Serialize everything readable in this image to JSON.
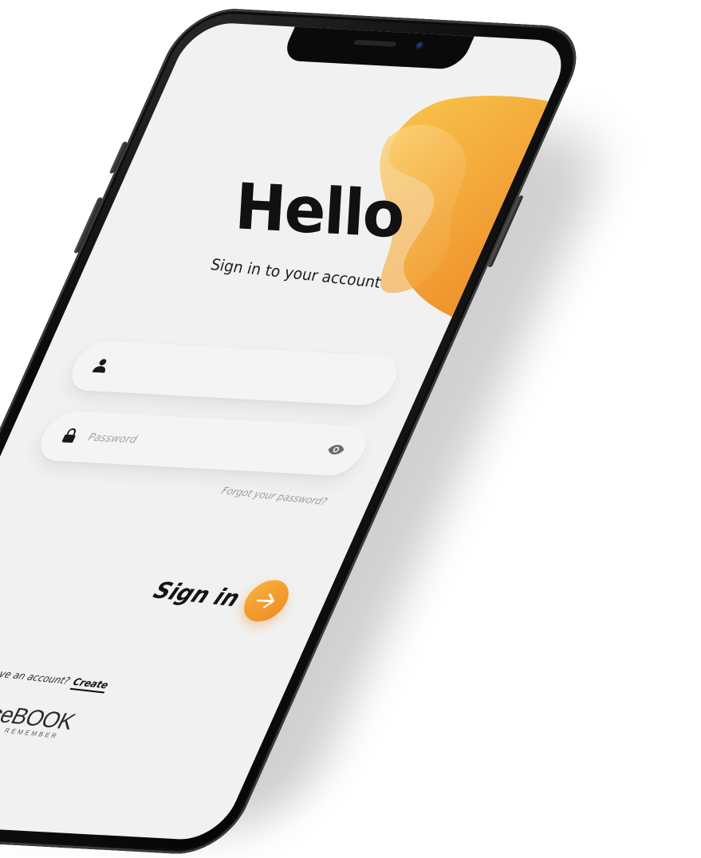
{
  "colors": {
    "accent": "#F39A2E",
    "accent_light": "#F7B23A",
    "background": "#F1F1F1",
    "text_primary": "#111111",
    "text_muted": "#9B9B9B"
  },
  "header": {
    "title": "Hello",
    "subtitle": "Sign in to your account"
  },
  "form": {
    "username": {
      "icon": "user-icon",
      "value": "",
      "placeholder": ""
    },
    "password": {
      "icon": "lock-icon",
      "value": "",
      "placeholder": "Password",
      "toggle_icon": "eye-icon"
    },
    "forgot_label": "Forgot your password?",
    "submit_label": "Sign in",
    "submit_icon": "arrow-right-icon"
  },
  "footer": {
    "signup_prompt": "Don't have an account?",
    "signup_link": "Create",
    "brand_name": "VoiceBOOK",
    "brand_tagline": "ALWAYS REMEMBER"
  }
}
